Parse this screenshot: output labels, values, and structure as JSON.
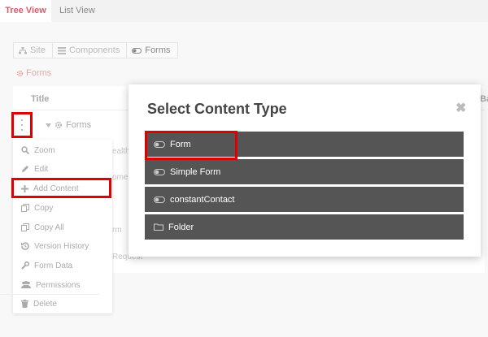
{
  "tabs": [
    {
      "label": "Tree View",
      "active": true
    },
    {
      "label": "List View",
      "active": false
    }
  ],
  "breadcrumb": [
    {
      "icon": "sitemap-icon",
      "label": "Site"
    },
    {
      "icon": "list-icon",
      "label": "Components"
    },
    {
      "icon": "toggle-icon",
      "label": "Forms"
    }
  ],
  "section": {
    "icon": "gear-icon",
    "label": "Forms"
  },
  "table": {
    "header_title": "Title",
    "header_right": "Ba",
    "row_label": "Forms",
    "partial_texts": [
      "ealth",
      "ome",
      "rm",
      "Request"
    ]
  },
  "context_menu": {
    "items": [
      {
        "icon": "zoom-icon",
        "label": "Zoom"
      },
      {
        "icon": "pencil-icon",
        "label": "Edit"
      },
      {
        "icon": "plus-icon",
        "label": "Add Content",
        "highlighted": true
      },
      {
        "icon": "copy-icon",
        "label": "Copy"
      },
      {
        "icon": "copy-all-icon",
        "label": "Copy All"
      },
      {
        "icon": "history-icon",
        "label": "Version History"
      },
      {
        "icon": "wrench-icon",
        "label": "Form Data"
      },
      {
        "icon": "users-icon",
        "label": "Permissions"
      },
      {
        "icon": "trash-icon",
        "label": "Delete"
      }
    ]
  },
  "modal": {
    "title": "Select Content Type",
    "close_glyph": "✖",
    "options": [
      {
        "icon": "toggle-icon",
        "label": "Form",
        "highlighted": true
      },
      {
        "icon": "toggle-icon",
        "label": "Simple Form"
      },
      {
        "icon": "toggle-icon",
        "label": "constantContact"
      },
      {
        "icon": "folder-icon",
        "label": "Folder"
      }
    ]
  },
  "colors": {
    "accent": "#e05a6a",
    "highlight": "#e00000",
    "option_bg": "#555555"
  }
}
